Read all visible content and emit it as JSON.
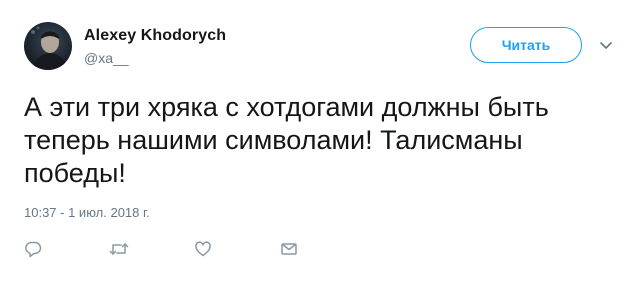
{
  "author": {
    "name": "Alexey Khodorych",
    "handle": "@xa__"
  },
  "follow_button": {
    "label": "Читать"
  },
  "tweet": {
    "text": "А эти три хряка с хотдогами должны быть теперь нашими символами! Талисманы победы!",
    "timestamp": "10:37 - 1 июл. 2018 г."
  },
  "actions": [
    {
      "icon": "reply-icon"
    },
    {
      "icon": "retweet-icon"
    },
    {
      "icon": "like-icon"
    },
    {
      "icon": "direct-message-icon"
    }
  ],
  "colors": {
    "accent": "#1da1f2",
    "secondary_text": "#657786",
    "primary_text": "#14171a",
    "icon_gray": "#8899a6"
  }
}
